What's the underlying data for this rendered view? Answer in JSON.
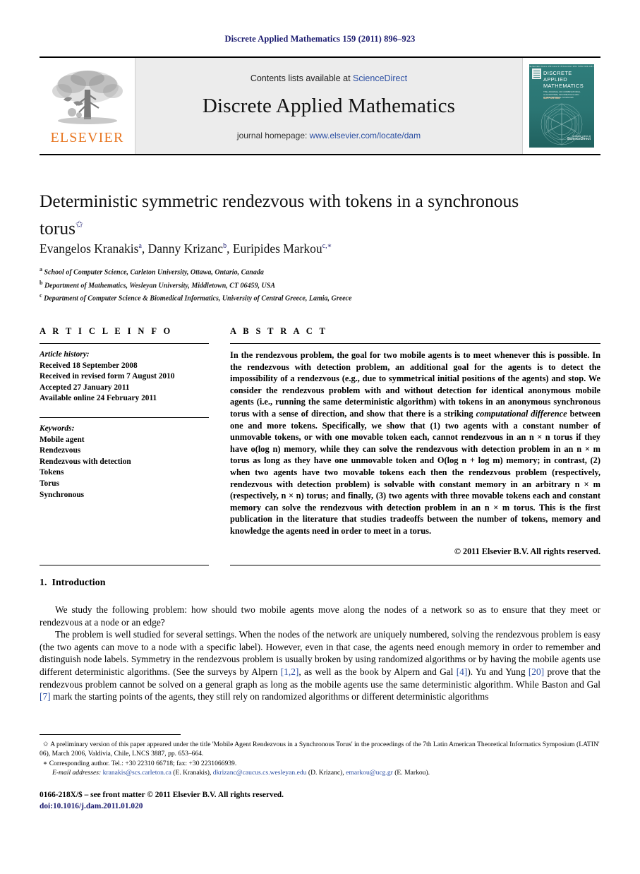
{
  "running_head": "Discrete Applied Mathematics 159 (2011) 896–923",
  "masthead": {
    "publisher_name": "ELSEVIER",
    "contents_prefix": "Contents lists available at ",
    "contents_link": "ScienceDirect",
    "journal_name": "Discrete Applied Mathematics",
    "homepage_prefix": "journal homepage: ",
    "homepage_url": "www.elsevier.com/locate/dam",
    "cover": {
      "top_strip": "ELSEVIER    Volume 159  Issue 9   15 December 2011    ISSN 0166-218X",
      "title_line1": "DISCRETE",
      "title_line2": "APPLIED",
      "title_line3": "MATHEMATICS",
      "subtitle": "THE JOURNAL OF COMBINATORIAL ALGORITHMS, INFORMATICS AND COMPUTATIONAL SCIENCES",
      "badge": "SUPPORTING",
      "footer_brand": "ScienceDirect",
      "footer_note": "Available online at"
    }
  },
  "article": {
    "title": "Deterministic symmetric rendezvous with tokens in a synchronous torus",
    "title_footnote_mark": "✩",
    "authors": [
      {
        "name": "Evangelos Kranakis",
        "mark": "a"
      },
      {
        "name": "Danny Krizanc",
        "mark": "b"
      },
      {
        "name": "Euripides Markou",
        "mark": "c,∗"
      }
    ],
    "affiliations": [
      {
        "mark": "a",
        "text": "School of Computer Science, Carleton University, Ottawa, Ontario, Canada"
      },
      {
        "mark": "b",
        "text": "Department of Mathematics, Wesleyan University, Middletown, CT 06459, USA"
      },
      {
        "mark": "c",
        "text": "Department of Computer Science & Biomedical Informatics, University of Central Greece, Lamia, Greece"
      }
    ]
  },
  "info": {
    "heading": "A R T I C L E    I N F O",
    "history_label": "Article history:",
    "history": [
      "Received 18 September 2008",
      "Received in revised form 7 August 2010",
      "Accepted 27 January 2011",
      "Available online 24 February 2011"
    ],
    "keywords_label": "Keywords:",
    "keywords": [
      "Mobile agent",
      "Rendezvous",
      "Rendezvous with detection",
      "Tokens",
      "Torus",
      "Synchronous"
    ]
  },
  "abstract": {
    "heading": "A B S T R A C T",
    "part1": "In the rendezvous problem, the goal for two mobile agents is to meet whenever this is possible. In the rendezvous with detection problem, an additional goal for the agents is to detect the impossibility of a rendezvous (e.g., due to symmetrical initial positions of the agents) and stop. We consider the rendezvous problem with and without detection for identical anonymous mobile agents (i.e., running the same deterministic algorithm) with tokens in an anonymous synchronous torus with a sense of direction, and show that there is a striking ",
    "emphasis": "computational difference",
    "part2": " between one and more tokens. Specifically, we show that (1) two agents with a constant number of unmovable tokens, or with one movable token each, cannot rendezvous in an n × n torus if they have o(log n) memory, while they can solve the rendezvous with detection problem in an n × m torus as long as they have one unmovable token and O(log n + log m) memory; in contrast, (2) when two agents have two movable tokens each then the rendezvous problem (respectively, rendezvous with detection problem) is solvable with constant memory in an arbitrary n × m (respectively, n × n) torus; and finally, (3) two agents with three movable tokens each and constant memory can solve the rendezvous with detection problem in an n × m torus. This is the first publication in the literature that studies tradeoffs between the number of tokens, memory and knowledge the agents need in order to meet in a torus.",
    "copyright": "© 2011 Elsevier B.V. All rights reserved."
  },
  "body": {
    "section_number": "1.",
    "section_title": "Introduction",
    "paragraph1": "We study the following problem: how should two mobile agents move along  the nodes of a network so as to ensure that they meet or rendezvous at a node or an edge?",
    "paragraph2_a": "The problem is well studied for several settings. When the nodes of the network are uniquely numbered, solving the rendezvous problem is easy (the two agents can move to a node with a specific label). However, even in that case, the agents need enough memory in order to remember and distinguish node labels. Symmetry in the rendezvous problem is usually broken by using randomized algorithms or by having the mobile agents use different deterministic algorithms. (See the surveys by Alpern ",
    "cite1": "[1,2]",
    "paragraph2_b": ", as well as the book by Alpern and Gal ",
    "cite2": "[4]",
    "paragraph2_c": "). Yu and Yung ",
    "cite3": "[20]",
    "paragraph2_d": " prove that the rendezvous problem cannot be solved on a general graph as long as the mobile agents use the same deterministic algorithm. While Baston and Gal ",
    "cite4": "[7]",
    "paragraph2_e": " mark the starting points of the agents, they still rely on randomized algorithms or different deterministic algorithms"
  },
  "footnotes": {
    "star_mark": "✩",
    "star_text": "A preliminary version of this paper appeared under the title 'Mobile Agent Rendezvous in a Synchronous Torus' in the proceedings of the 7th Latin American Theoretical Informatics Symposium (LATIN' 06), March 2006, Valdivia, Chile, LNCS 3887, pp. 653–664.",
    "corr_mark": "∗",
    "corr_text": "Corresponding author. Tel.: +30 22310 66718; fax: +30 2231066939.",
    "email_label": "E-mail addresses:",
    "emails": [
      {
        "address": "kranakis@scs.carleton.ca",
        "owner": "(E. Kranakis)"
      },
      {
        "address": "dkrizanc@caucus.cs.wesleyan.edu",
        "owner": "(D. Krizanc)"
      },
      {
        "address": "emarkou@ucg.gr",
        "owner": "(E. Markou)"
      }
    ]
  },
  "imprint": {
    "issn_line": "0166-218X/$ – see front matter © 2011 Elsevier B.V. All rights reserved.",
    "doi_line": "doi:10.1016/j.dam.2011.01.020"
  }
}
